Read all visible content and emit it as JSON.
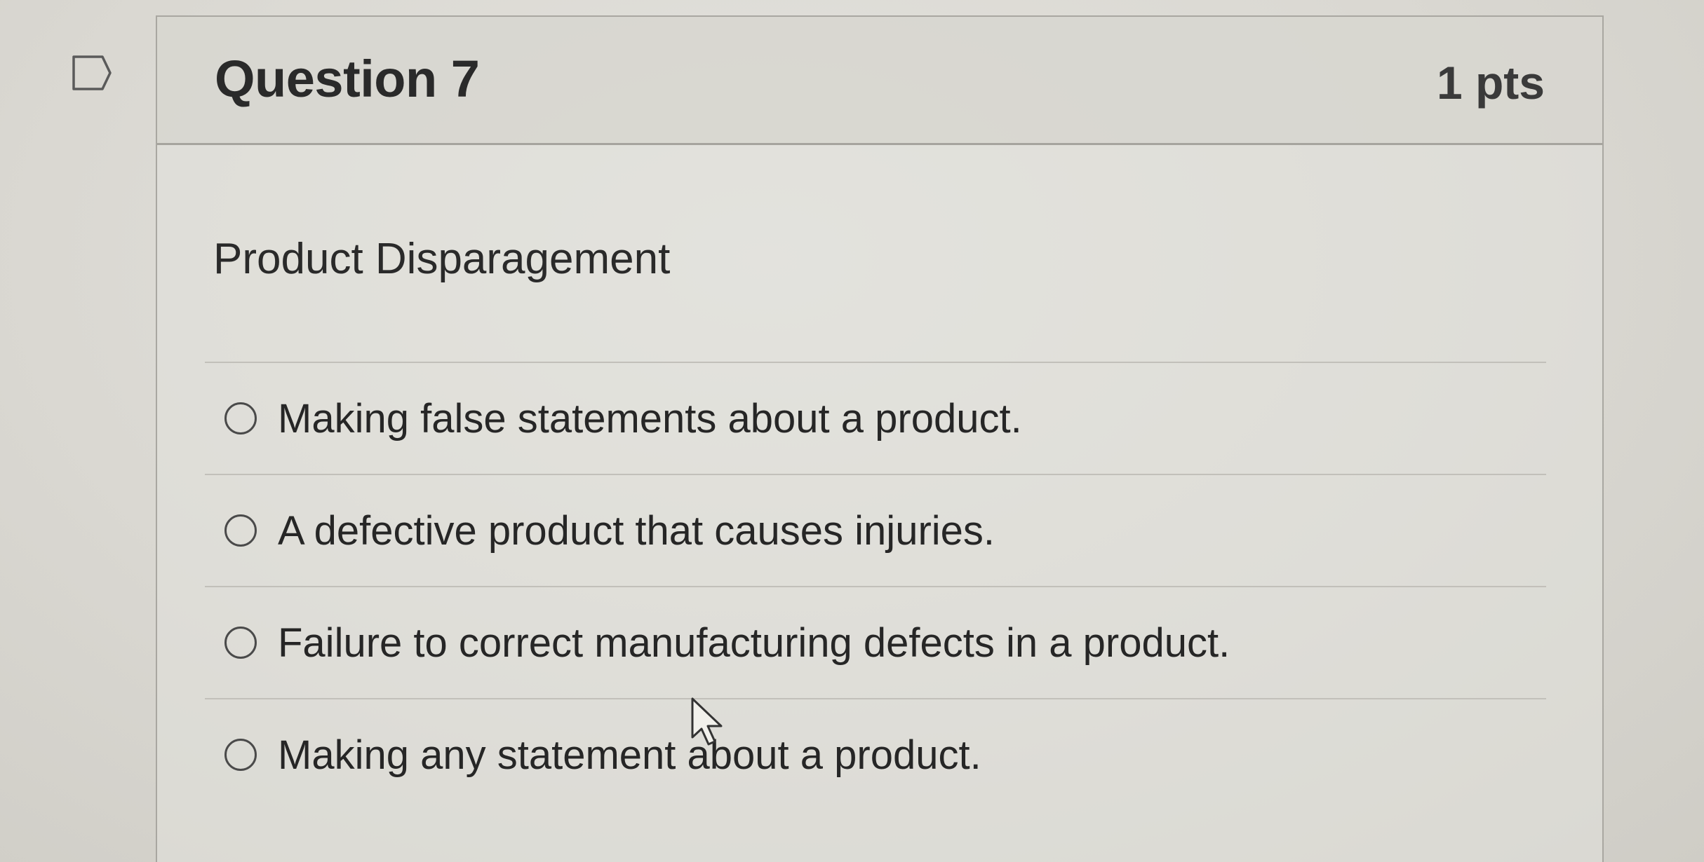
{
  "question": {
    "title": "Question 7",
    "points": "1 pts",
    "text": "Product Disparagement"
  },
  "answers": [
    {
      "label": "Making false statements about a product.",
      "selected": false
    },
    {
      "label": "A defective product that causes injuries.",
      "selected": false
    },
    {
      "label": "Failure to correct manufacturing defects in a product.",
      "selected": false
    },
    {
      "label": "Making any statement about a product.",
      "selected": false
    }
  ],
  "icons": {
    "flag": "flag-outline-icon",
    "cursor": "mouse-pointer-icon"
  },
  "colors": {
    "text": "#2a2a2a",
    "border": "#a9a7a1",
    "header_bg": "#d6d4ce",
    "radio": "#4a4a4a"
  }
}
